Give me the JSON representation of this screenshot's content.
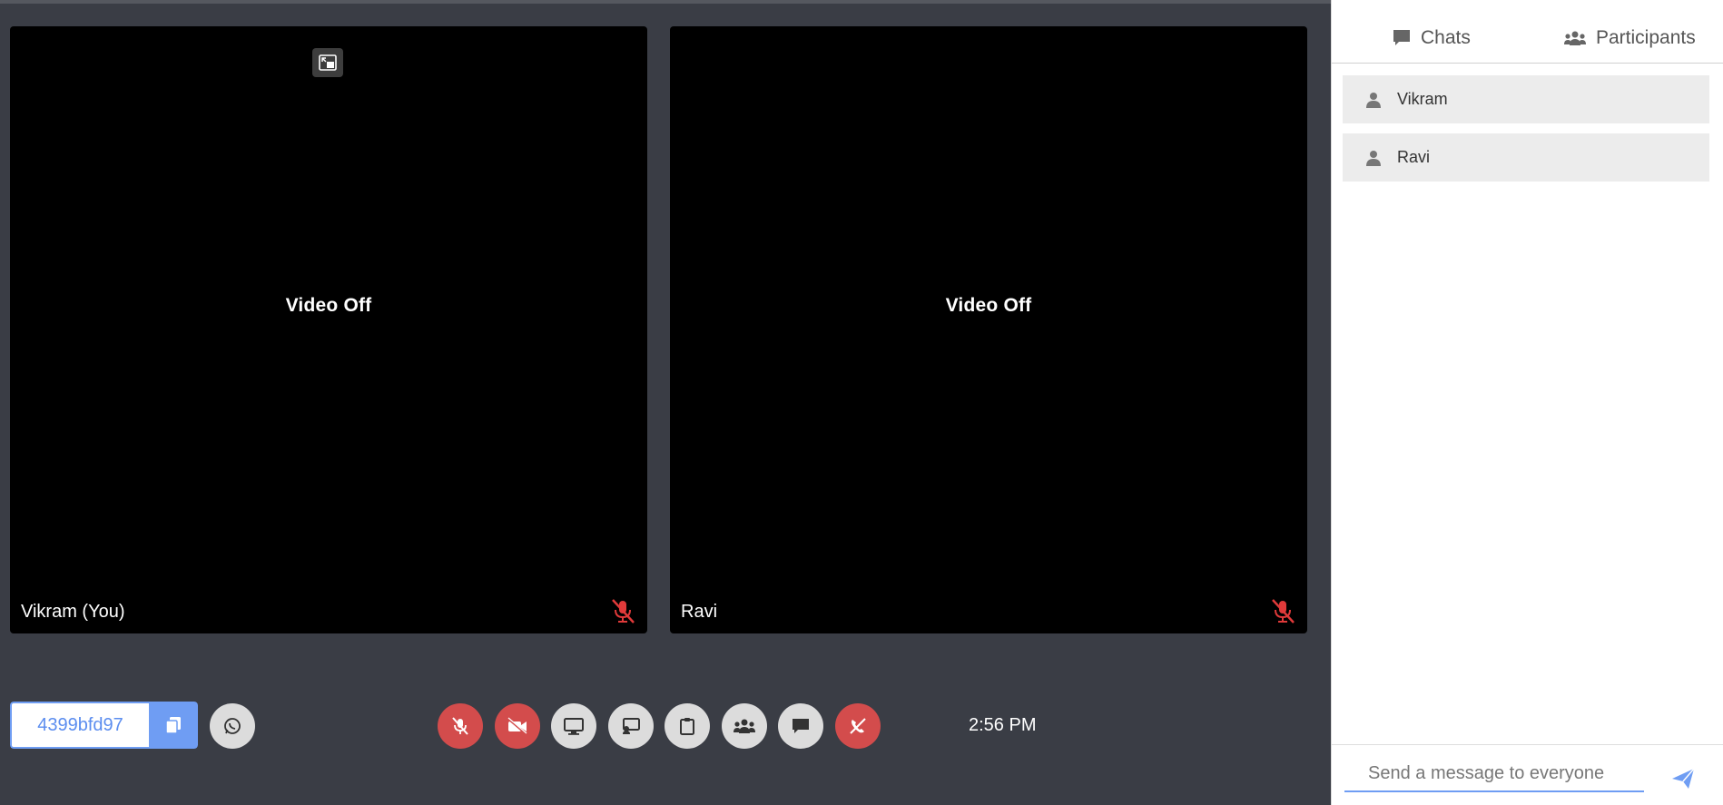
{
  "tiles": [
    {
      "status": "Video Off",
      "name": "Vikram (You)"
    },
    {
      "status": "Video Off",
      "name": "Ravi"
    }
  ],
  "toolbar": {
    "meeting_id": "4399bfd97",
    "clock": "2:56 PM",
    "buttons": [
      {
        "icon": "mic-off-icon",
        "style": "red"
      },
      {
        "icon": "video-off-icon",
        "style": "red"
      },
      {
        "icon": "screen-share-icon",
        "style": "grey"
      },
      {
        "icon": "cast-icon",
        "style": "grey"
      },
      {
        "icon": "clipboard-icon",
        "style": "grey"
      },
      {
        "icon": "participants-icon",
        "style": "grey"
      },
      {
        "icon": "chat-icon",
        "style": "grey"
      },
      {
        "icon": "hangup-icon",
        "style": "red"
      }
    ]
  },
  "sidebar": {
    "tabs": {
      "chats": "Chats",
      "participants": "Participants"
    },
    "participants": [
      "Vikram",
      "Ravi"
    ],
    "message_placeholder": "Send a message to everyone"
  },
  "colors": {
    "accent": "#6f9df3",
    "danger": "#d34c4c",
    "background": "#3a3d45"
  }
}
